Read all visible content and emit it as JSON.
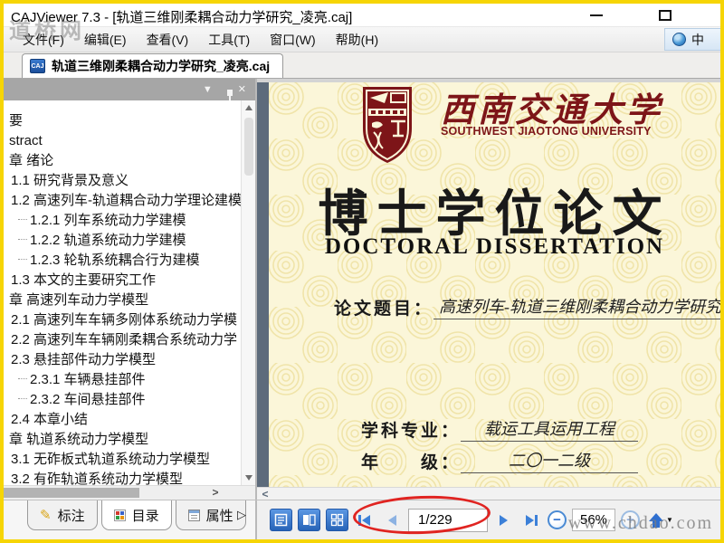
{
  "window": {
    "title": "CAJViewer 7.3 - [轨道三维刚柔耦合动力学研究_凌亮.caj]"
  },
  "watermarks": {
    "top_left": "道桥网",
    "bottom_right": "www.chdao.com"
  },
  "menu": {
    "items": [
      "文件(F)",
      "编辑(E)",
      "查看(V)",
      "工具(T)",
      "窗口(W)",
      "帮助(H)"
    ],
    "language": "中"
  },
  "tab": {
    "icon_text": "CAJ",
    "label": "轨道三维刚柔耦合动力学研究_凌亮.caj"
  },
  "sidebar": {
    "toc_items": [
      {
        "text": "要",
        "level": 0
      },
      {
        "text": "stract",
        "level": 0
      },
      {
        "text": "章 绪论",
        "level": 0
      },
      {
        "text": "1.1 研究背景及意义",
        "level": 1
      },
      {
        "text": "1.2 高速列车-轨道耦合动力学理论建模",
        "level": 1
      },
      {
        "text": "1.2.1 列车系统动力学建模",
        "level": 2
      },
      {
        "text": "1.2.2 轨道系统动力学建模",
        "level": 2
      },
      {
        "text": "1.2.3 轮轨系统耦合行为建模",
        "level": 2
      },
      {
        "text": "1.3 本文的主要研究工作",
        "level": 1
      },
      {
        "text": "章 高速列车动力学模型",
        "level": 0
      },
      {
        "text": "2.1 高速列车车辆多刚体系统动力学模",
        "level": 1
      },
      {
        "text": "2.2 高速列车车辆刚柔耦合系统动力学",
        "level": 1
      },
      {
        "text": "2.3 悬挂部件动力学模型",
        "level": 1
      },
      {
        "text": "2.3.1 车辆悬挂部件",
        "level": 2
      },
      {
        "text": "2.3.2 车间悬挂部件",
        "level": 2
      },
      {
        "text": "2.4 本章小结",
        "level": 1
      },
      {
        "text": "章 轨道系统动力学模型",
        "level": 0
      },
      {
        "text": "3.1 无砟板式轨道系统动力学模型",
        "level": 1
      },
      {
        "text": "3.2 有砟轨道系统动力学模型",
        "level": 1
      }
    ],
    "bottom_tabs": {
      "annotation": "标注",
      "contents": "目录",
      "properties": "属性"
    },
    "overflow_arrow": "▷"
  },
  "document_page": {
    "university_cn": "西南交通大学",
    "university_en": "SOUTHWEST JIAOTONG UNIVERSITY",
    "degree_title_cn": "博士学位论文",
    "degree_title_en": "DOCTORAL DISSERTATION",
    "thesis_title_label": "论文题目：",
    "thesis_title": "高速列车-轨道三维刚柔耦合动力学研究",
    "major_label": "学科专业：",
    "major": "载运工具运用工程",
    "grade_label": "年　　级：",
    "grade": "二〇一二级"
  },
  "toolbar": {
    "page_indicator": "1/229",
    "zoom_level": "56%"
  },
  "icons": {
    "panel_collapse": "▼",
    "panel_close": "✕",
    "scroll_right": ">",
    "scroll_left": "<",
    "pencil": "✎",
    "dropdown_small": "▼",
    "zoom_out": "−",
    "zoom_in": "+"
  },
  "colors": {
    "frame_yellow": "#f6d505",
    "maroon": "#7d1518",
    "page_bg": "#fbf6d9",
    "pattern": "#f0e4a9",
    "accent_blue": "#2e6fd0",
    "annotation_red": "#e02421"
  }
}
